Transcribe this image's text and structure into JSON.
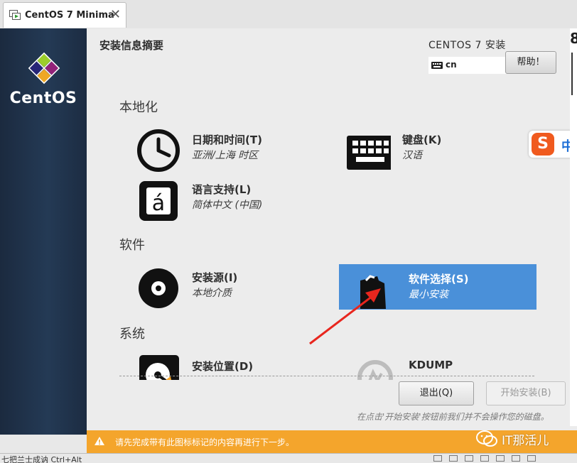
{
  "window": {
    "tab_title": "CentOS 7 Minima",
    "close_symbol": "✕"
  },
  "sidebar": {
    "brand": "CentOS"
  },
  "header": {
    "page_title": "安装信息摘要",
    "product_title": "CENTOS 7 安装",
    "keyboard_layout": "cn",
    "help_button": "帮助！"
  },
  "sections": [
    {
      "title": "本地化",
      "spokes": [
        {
          "icon": "clock-icon",
          "name": "日期和时间(T)",
          "status": "亚洲/上海 时区",
          "selected": false
        },
        {
          "icon": "keyboard-icon",
          "name": "键盘(K)",
          "status": "汉语",
          "selected": false
        },
        {
          "icon": "language-icon",
          "name": "语言支持(L)",
          "status": "简体中文 (中国)",
          "selected": false
        }
      ]
    },
    {
      "title": "软件",
      "spokes": [
        {
          "icon": "disc-icon",
          "name": "安装源(I)",
          "status": "本地介质",
          "selected": false
        },
        {
          "icon": "software-package-icon",
          "name": "软件选择(S)",
          "status": "最小安装",
          "selected": true
        }
      ]
    },
    {
      "title": "系统",
      "spokes": [
        {
          "icon": "disk-icon",
          "name": "安装位置(D)",
          "status": "",
          "selected": false
        },
        {
          "icon": "kdump-icon",
          "name": "KDUMP",
          "status": "",
          "selected": false
        }
      ]
    }
  ],
  "footer": {
    "quit_button": "退出(Q)",
    "begin_button": "开始安装(B)",
    "hint": "在点击'开始安装'按钮前我们并不会操作您的磁盘。"
  },
  "warning": {
    "text": "请先完成带有此图标标记的内容再进行下一步。"
  },
  "overlay": {
    "wechat_label": "IT那活儿",
    "ime_mode": "中",
    "ime_logo": "S"
  },
  "statusbar": {
    "text": "七把兰士成讷 Ctrl+Alt"
  },
  "colors": {
    "selected_spoke": "#4a90d9",
    "warning_bar": "#f4a52c",
    "annotation_arrow": "#e8261e",
    "sidebar": "#1f3048"
  }
}
